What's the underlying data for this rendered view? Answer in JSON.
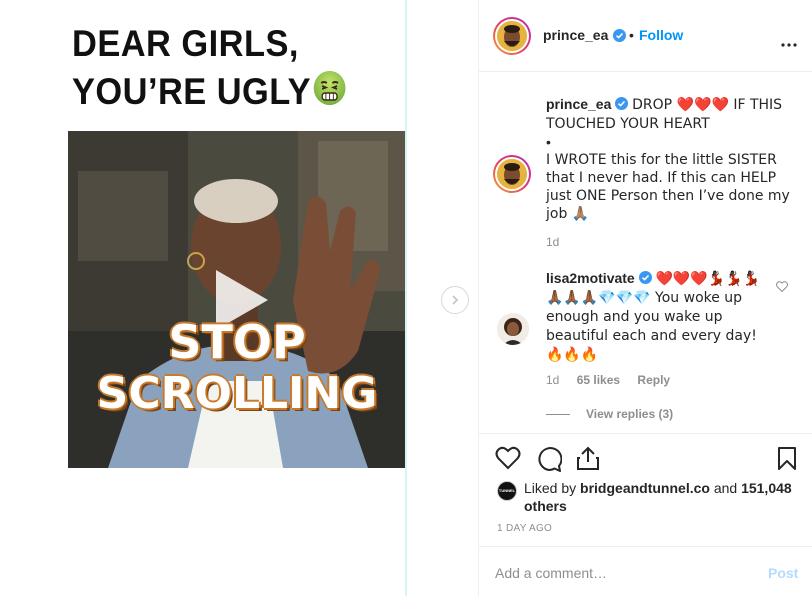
{
  "post": {
    "headline_line1": "DEAR GIRLS,",
    "headline_line2": "YOU’RE UGLY",
    "video_text_line1": "STOP",
    "video_text_line2": "SCROLLING"
  },
  "header": {
    "username": "prince_ea",
    "separator": "•",
    "follow_label": "Follow"
  },
  "caption": {
    "username": "prince_ea",
    "text_part1": "DROP ❤️❤️❤️ IF THIS TOUCHED YOUR HEART",
    "bullet": "•",
    "text_part2": "I WROTE this for the little SISTER that I never had. If this can HELP just ONE Person then I’ve done my job 🙏🏽",
    "time": "1d"
  },
  "comment": {
    "username": "lisa2motivate",
    "text": "❤️❤️❤️💃🏿💃🏿💃🏿🙏🏾🙏🏾🙏🏾💎💎💎 You woke up enough and you wake up beautiful each and every day! 🔥🔥🔥",
    "time": "1d",
    "likes": "65 likes",
    "reply_label": "Reply",
    "view_replies": "View replies (3)"
  },
  "likes": {
    "prefix": "Liked by",
    "liker": "bridgeandtunnel.co",
    "and": "and",
    "others": "151,048 others",
    "liker_logo_text": "TUNNEL"
  },
  "post_age": "1 DAY AGO",
  "comment_box": {
    "placeholder": "Add a comment…",
    "post_label": "Post"
  },
  "colors": {
    "accent": "#0095f6",
    "verified": "#3897f0",
    "muted": "#8e8e8e"
  },
  "icons": [
    "nauseated-face-icon",
    "play-icon",
    "chevron-right-icon",
    "verified-icon",
    "more-icon",
    "heart-icon",
    "comment-icon",
    "share-icon",
    "bookmark-icon"
  ]
}
